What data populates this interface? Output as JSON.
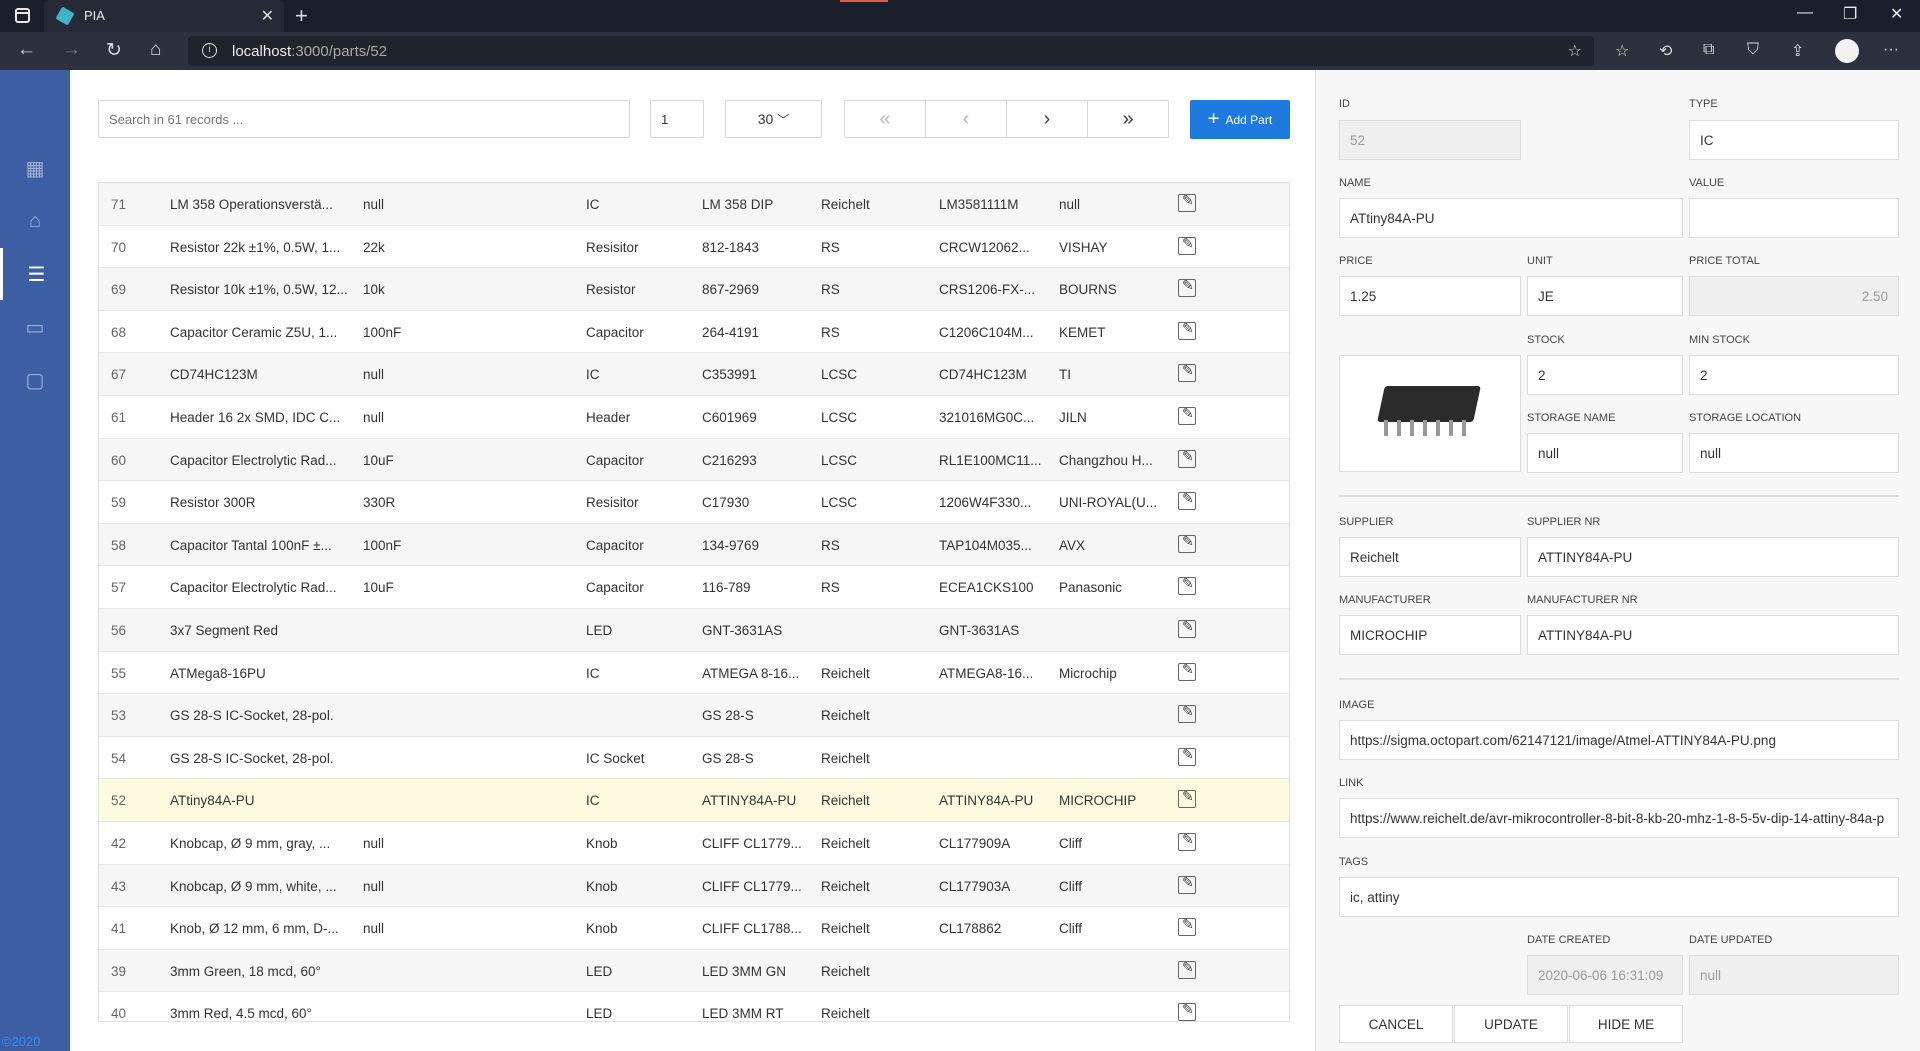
{
  "browser": {
    "tab_title": "PIA",
    "url_host": "localhost",
    "url_path": ":3000/parts/52"
  },
  "sidebar": {
    "items": [
      {
        "icon": "dashboard-icon"
      },
      {
        "icon": "home-icon"
      },
      {
        "icon": "list-icon",
        "active": true
      },
      {
        "icon": "inbox-icon"
      },
      {
        "icon": "message-icon"
      }
    ],
    "copyright": "©2020"
  },
  "toolbar": {
    "search_placeholder": "Search in 61 records ...",
    "page": "1",
    "page_size": "30",
    "add_label": "Add Part"
  },
  "table": {
    "rows": [
      {
        "id": "71",
        "name": "LM 358 Operationsverstä...",
        "value": "null",
        "type": "IC",
        "supplier_nr": "LM 358 DIP",
        "supplier": "Reichelt",
        "manufacturer_nr": "LM3581111M",
        "manufacturer": "null"
      },
      {
        "id": "70",
        "name": "Resistor 22k ±1%, 0.5W, 1...",
        "value": "22k",
        "type": "Resisitor",
        "supplier_nr": "812-1843",
        "supplier": "RS",
        "manufacturer_nr": "CRCW12062...",
        "manufacturer": "VISHAY"
      },
      {
        "id": "69",
        "name": "Resistor 10k ±1%, 0.5W, 12...",
        "value": "10k",
        "type": "Resistor",
        "supplier_nr": "867-2969",
        "supplier": "RS",
        "manufacturer_nr": "CRS1206-FX-...",
        "manufacturer": "BOURNS"
      },
      {
        "id": "68",
        "name": "Capacitor Ceramic Z5U, 1...",
        "value": "100nF",
        "type": "Capacitor",
        "supplier_nr": "264-4191",
        "supplier": "RS",
        "manufacturer_nr": "C1206C104M...",
        "manufacturer": "KEMET"
      },
      {
        "id": "67",
        "name": "CD74HC123M",
        "value": "null",
        "type": "IC",
        "supplier_nr": "C353991",
        "supplier": "LCSC",
        "manufacturer_nr": "CD74HC123M",
        "manufacturer": "TI"
      },
      {
        "id": "61",
        "name": "Header 16 2x SMD, IDC C...",
        "value": "null",
        "type": "Header",
        "supplier_nr": "C601969",
        "supplier": "LCSC",
        "manufacturer_nr": "321016MG0C...",
        "manufacturer": "JILN"
      },
      {
        "id": "60",
        "name": "Capacitor Electrolytic Rad...",
        "value": "10uF",
        "type": "Capacitor",
        "supplier_nr": "C216293",
        "supplier": "LCSC",
        "manufacturer_nr": "RL1E100MC11...",
        "manufacturer": "Changzhou H..."
      },
      {
        "id": "59",
        "name": "Resistor 300R",
        "value": "330R",
        "type": "Resisitor",
        "supplier_nr": "C17930",
        "supplier": "LCSC",
        "manufacturer_nr": "1206W4F330...",
        "manufacturer": "UNI-ROYAL(U..."
      },
      {
        "id": "58",
        "name": "Capacitor Tantal 100nF ±...",
        "value": "100nF",
        "type": "Capacitor",
        "supplier_nr": "134-9769",
        "supplier": "RS",
        "manufacturer_nr": "TAP104M035...",
        "manufacturer": "AVX"
      },
      {
        "id": "57",
        "name": "Capacitor Electrolytic Rad...",
        "value": "10uF",
        "type": "Capacitor",
        "supplier_nr": "116-789",
        "supplier": "RS",
        "manufacturer_nr": "ECEA1CKS100",
        "manufacturer": "Panasonic"
      },
      {
        "id": "56",
        "name": "3x7 Segment Red",
        "value": "",
        "type": "LED",
        "supplier_nr": "GNT-3631AS",
        "supplier": "",
        "manufacturer_nr": "GNT-3631AS",
        "manufacturer": ""
      },
      {
        "id": "55",
        "name": "ATMega8-16PU",
        "value": "",
        "type": "IC",
        "supplier_nr": "ATMEGA 8-16...",
        "supplier": "Reichelt",
        "manufacturer_nr": "ATMEGA8-16...",
        "manufacturer": "Microchip"
      },
      {
        "id": "53",
        "name": "GS 28-S IC-Socket, 28-pol.",
        "value": "",
        "type": "",
        "supplier_nr": "GS 28-S",
        "supplier": "Reichelt",
        "manufacturer_nr": "",
        "manufacturer": ""
      },
      {
        "id": "54",
        "name": "GS 28-S IC-Socket, 28-pol.",
        "value": "",
        "type": "IC Socket",
        "supplier_nr": "GS 28-S",
        "supplier": "Reichelt",
        "manufacturer_nr": "",
        "manufacturer": ""
      },
      {
        "id": "52",
        "name": "ATtiny84A-PU",
        "value": "",
        "type": "IC",
        "supplier_nr": "ATTINY84A-PU",
        "supplier": "Reichelt",
        "manufacturer_nr": "ATTINY84A-PU",
        "manufacturer": "MICROCHIP",
        "selected": true
      },
      {
        "id": "42",
        "name": "Knobcap, Ø 9 mm, gray, ...",
        "value": "null",
        "type": "Knob",
        "supplier_nr": "CLIFF CL1779...",
        "supplier": "Reichelt",
        "manufacturer_nr": "CL177909A",
        "manufacturer": "Cliff"
      },
      {
        "id": "43",
        "name": "Knobcap, Ø 9 mm, white, ...",
        "value": "null",
        "type": "Knob",
        "supplier_nr": "CLIFF CL1779...",
        "supplier": "Reichelt",
        "manufacturer_nr": "CL177903A",
        "manufacturer": "Cliff"
      },
      {
        "id": "41",
        "name": "Knob, Ø 12 mm, 6 mm, D-...",
        "value": "null",
        "type": "Knob",
        "supplier_nr": "CLIFF CL1788...",
        "supplier": "Reichelt",
        "manufacturer_nr": "CL178862",
        "manufacturer": "Cliff"
      },
      {
        "id": "39",
        "name": "3mm Green, 18 mcd, 60°",
        "value": "",
        "type": "LED",
        "supplier_nr": "LED 3MM GN",
        "supplier": "Reichelt",
        "manufacturer_nr": "",
        "manufacturer": ""
      },
      {
        "id": "40",
        "name": "3mm Red, 4.5 mcd, 60°",
        "value": "",
        "type": "LED",
        "supplier_nr": "LED 3MM RT",
        "supplier": "Reichelt",
        "manufacturer_nr": "",
        "manufacturer": ""
      }
    ]
  },
  "detail": {
    "labels": {
      "id": "ID",
      "type": "TYPE",
      "name": "NAME",
      "value": "VALUE",
      "price": "PRICE",
      "unit": "UNIT",
      "price_total": "PRICE TOTAL",
      "stock": "STOCK",
      "min_stock": "MIN STOCK",
      "storage_name": "STORAGE NAME",
      "storage_location": "STORAGE LOCATION",
      "supplier": "SUPPLIER",
      "supplier_nr": "SUPPLIER NR",
      "manufacturer": "MANUFACTURER",
      "manufacturer_nr": "MANUFACTURER NR",
      "image": "IMAGE",
      "link": "LINK",
      "tags": "TAGS",
      "date_created": "DATE CREATED",
      "date_updated": "DATE UPDATED"
    },
    "values": {
      "id": "52",
      "type": "IC",
      "name": "ATtiny84A-PU",
      "value": "",
      "price": "1.25",
      "unit": "JE",
      "price_total": "2.50",
      "stock": "2",
      "min_stock": "2",
      "storage_name": "null",
      "storage_location": "null",
      "supplier": "Reichelt",
      "supplier_nr": "ATTINY84A-PU",
      "manufacturer": "MICROCHIP",
      "manufacturer_nr": "ATTINY84A-PU",
      "image": "https://sigma.octopart.com/62147121/image/Atmel-ATTINY84A-PU.png",
      "link": "https://www.reichelt.de/avr-mikrocontroller-8-bit-8-kb-20-mhz-1-8-5-5v-dip-14-attiny-84a-p",
      "tags": "ic, attiny",
      "date_created": "2020-06-06 16:31:09",
      "date_updated": "null"
    },
    "buttons": {
      "cancel": "CANCEL",
      "update": "UPDATE",
      "hide": "HIDE ME"
    }
  }
}
